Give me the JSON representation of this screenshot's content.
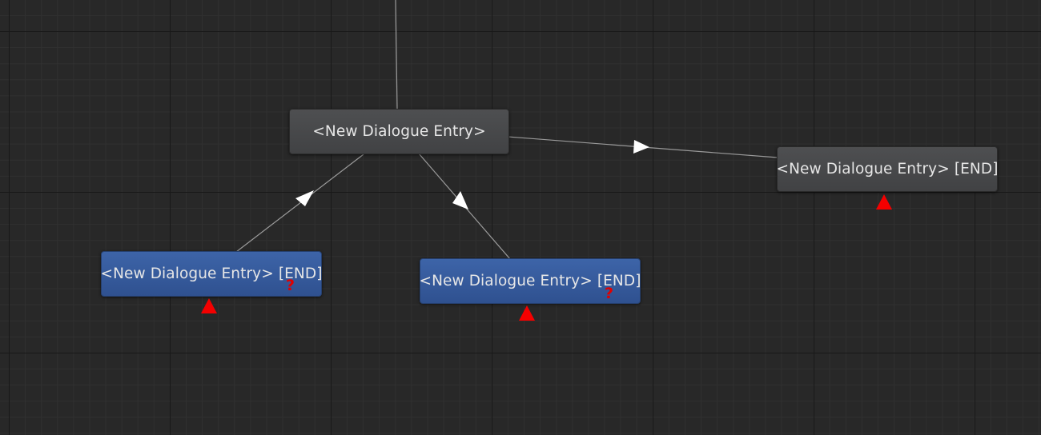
{
  "nodes": {
    "root": {
      "label": "<New Dialogue Entry>",
      "style": "gray"
    },
    "end_right": {
      "label": "<New Dialogue Entry> [END]",
      "style": "gray"
    },
    "end_left": {
      "label": "<New Dialogue Entry> [END]",
      "style": "blue"
    },
    "end_middle": {
      "label": "<New Dialogue Entry> [END]",
      "style": "blue"
    }
  },
  "icons": {
    "warning": "warning-triangle-icon",
    "condition": "question-mark-icon",
    "condition_glyph": "?",
    "link_arrow": "link-arrow-icon"
  },
  "colors": {
    "canvas_bg": "#282828",
    "grid_major": "#181818",
    "grid_minor": "#303030",
    "node_gray": "#47484a",
    "node_blue": "#345aa0",
    "link_line": "#9a9a9a",
    "arrow": "#ffffff",
    "warning": "#f40000"
  }
}
